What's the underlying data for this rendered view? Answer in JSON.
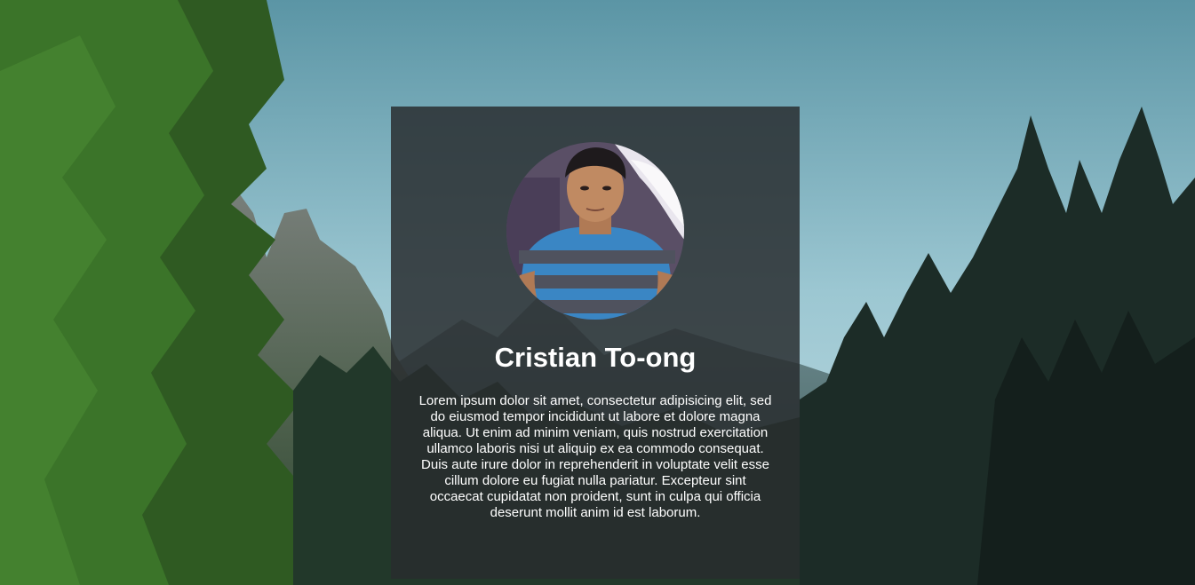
{
  "profile": {
    "name": "Cristian To-ong",
    "bio": "Lorem ipsum dolor sit amet, consectetur adipisicing elit, sed do eiusmod tempor incididunt ut labore et dolore magna aliqua. Ut enim ad minim veniam, quis nostrud exercitation ullamco laboris nisi ut aliquip ex ea commodo consequat. Duis aute irure dolor in reprehenderit in voluptate velit esse cillum dolore eu fugiat nulla pariatur. Excepteur sint occaecat cupidatat non proident, sunt in culpa qui officia deserunt mollit anim id est laborum."
  },
  "icons": {
    "background": "mountain-forest-landscape",
    "avatar": "profile-photo"
  },
  "colors": {
    "card_background": "rgba(40, 44, 46, 0.84)",
    "text": "#ffffff",
    "sky": "#7fb3c2",
    "forest_light": "#3f6b2c",
    "forest_dark": "#1b2a24"
  }
}
